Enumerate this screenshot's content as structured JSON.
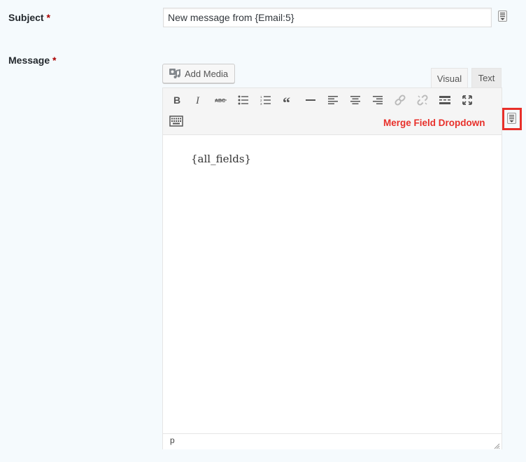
{
  "subject": {
    "label": "Subject",
    "required_mark": "*",
    "value": "New message from {Email:5}"
  },
  "message": {
    "label": "Message",
    "required_mark": "*",
    "add_media_label": "Add Media",
    "tabs": [
      {
        "label": "Visual",
        "active": true
      },
      {
        "label": "Text",
        "active": false
      }
    ],
    "toolbar_icons": [
      "bold-icon",
      "italic-icon",
      "strikethrough-icon",
      "bullet-list-icon",
      "numbered-list-icon",
      "blockquote-icon",
      "horizontal-rule-icon",
      "align-left-icon",
      "align-center-icon",
      "align-right-icon",
      "insert-link-icon",
      "remove-link-icon",
      "read-more-icon",
      "fullscreen-icon",
      "toolbar-toggle-icon"
    ],
    "content": "{all_fields}",
    "status_path": "p"
  },
  "annotation": {
    "label": "Merge Field Dropdown",
    "color": "#e8302a"
  }
}
